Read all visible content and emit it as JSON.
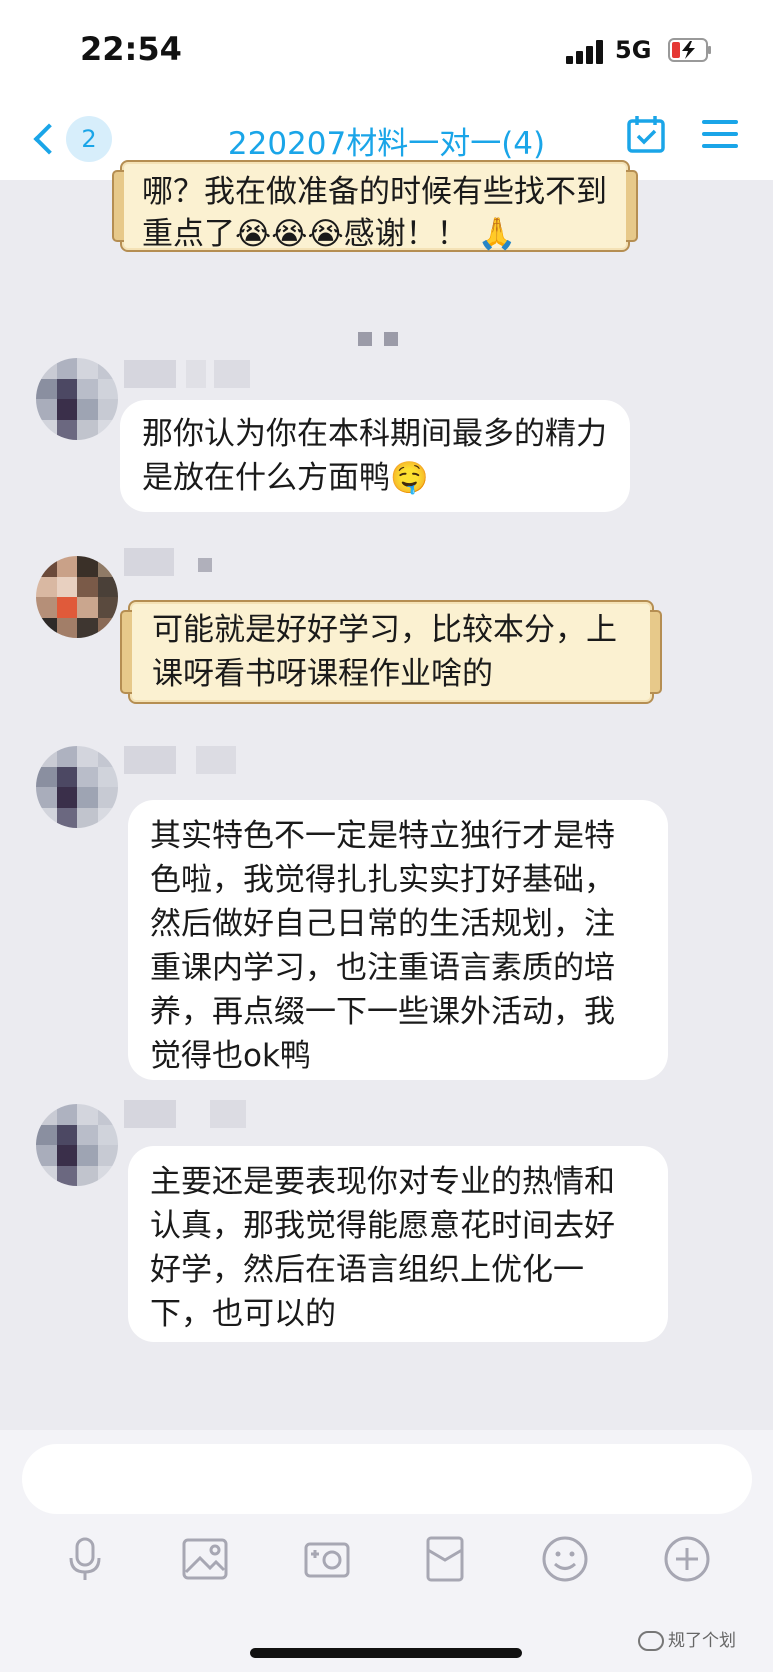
{
  "status": {
    "time": "22:54",
    "network": "5G"
  },
  "nav": {
    "unread_count": "2",
    "title": "220207材料一对一(4)"
  },
  "messages": [
    {
      "lines": [
        "哪？我在做准备的时候有些找不到",
        "重点了😭😭😭感谢！！ 🙏"
      ]
    },
    {
      "lines": [
        "那你认为你在本科期间最多的精力",
        "是放在什么方面鸭🤤"
      ]
    },
    {
      "lines": [
        "可能就是好好学习，比较本分，上",
        "课呀看书呀课程作业啥的"
      ]
    },
    {
      "lines": [
        "其实特色不一定是特立独行才是特",
        "色啦，我觉得扎扎实实打好基础，",
        "然后做好自己日常的生活规划，注",
        "重课内学习，也注重语言素质的培",
        "养，再点缀一下一些课外活动，我",
        "觉得也ok鸭"
      ]
    },
    {
      "lines": [
        "主要还是要表现你对专业的热情和",
        "认真，那我觉得能愿意花时间去好",
        "好学，然后在语言组织上优化一",
        "下，也可以的"
      ]
    }
  ],
  "toolbar": {
    "icons": [
      "microphone-icon",
      "image-icon",
      "camera-icon",
      "red-envelope-icon",
      "emoji-icon",
      "plus-icon"
    ]
  },
  "watermark": "规了个划",
  "colors": {
    "accent": "#1aa5e8",
    "chat_bg": "#ebebf0",
    "scroll_bubble": "#fbf1d1"
  }
}
